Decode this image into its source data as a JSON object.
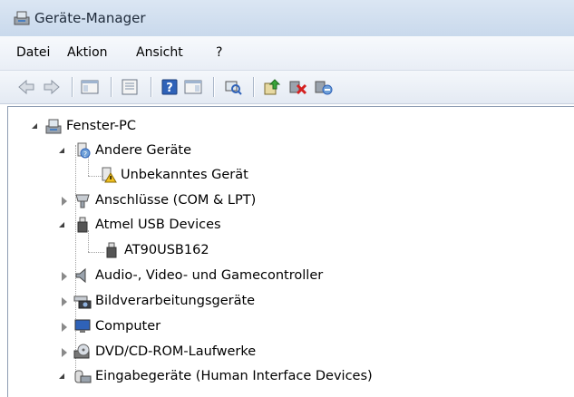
{
  "window": {
    "title": "Geräte-Manager"
  },
  "menu": {
    "items": [
      "Datei",
      "Aktion",
      "Ansicht",
      "?"
    ]
  },
  "toolbar": {
    "buttons": [
      "back-icon",
      "forward-icon",
      "show-hide-console-tree-icon",
      "properties-icon",
      "help-icon",
      "action-pane-icon",
      "scan-hardware-icon",
      "update-driver-icon",
      "uninstall-icon",
      "disable-icon"
    ]
  },
  "tree": {
    "root": "Fenster-PC",
    "andere_geraete": "Andere Geräte",
    "unbekanntes_geraet": "Unbekanntes Gerät",
    "anschluesse": "Anschlüsse (COM & LPT)",
    "atmel": "Atmel USB Devices",
    "at90": "AT90USB162",
    "audio": "Audio-, Video- und Gamecontroller",
    "bild": "Bildverarbeitungsgeräte",
    "computer": "Computer",
    "dvd": "DVD/CD-ROM-Laufwerke",
    "eingabe": "Eingabegeräte (Human Interface Devices)"
  },
  "colors": {
    "accent": "#c9d9ec",
    "warning": "#f0c020",
    "delete": "#d42020"
  }
}
